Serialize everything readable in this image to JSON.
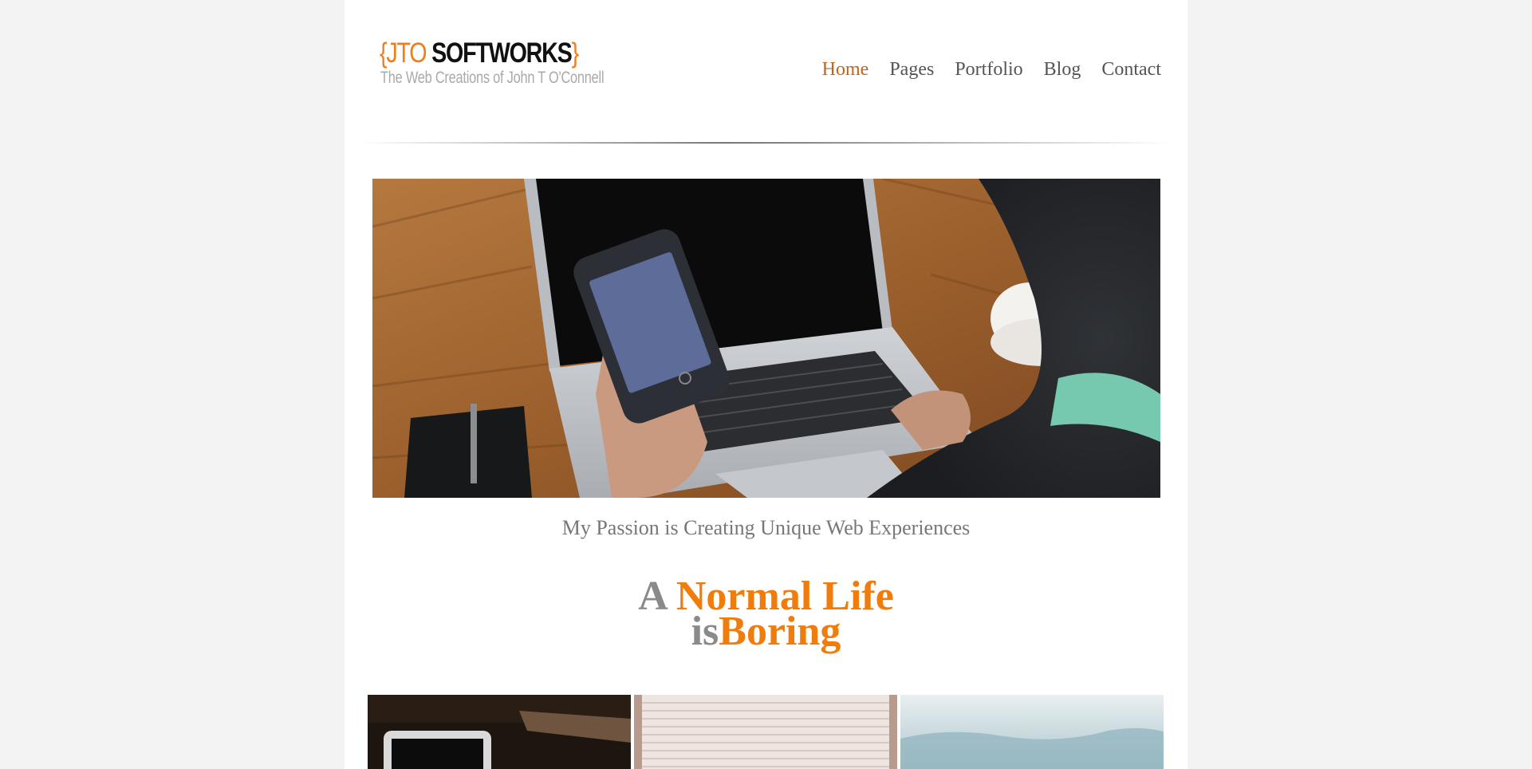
{
  "header": {
    "logo": {
      "open_brace": "{",
      "jto": "JTO",
      "softworks": " SOFTWORKS",
      "close_brace": "}"
    },
    "tagline": "The Web Creations of John T O'Connell",
    "nav": [
      {
        "label": "Home",
        "active": true
      },
      {
        "label": "Pages",
        "active": false
      },
      {
        "label": "Portfolio",
        "active": false
      },
      {
        "label": "Blog",
        "active": false
      },
      {
        "label": "Contact",
        "active": false
      }
    ]
  },
  "hero": {
    "caption": "My Passion is Creating Unique Web Experiences"
  },
  "headline": {
    "line1_a": "A ",
    "line1_b": "Normal Life",
    "line2_a": "is",
    "line2_b": "Boring"
  },
  "colors": {
    "accent": "#f07c0c",
    "nav_active": "#c0651a",
    "page_bg": "#f3f3f3"
  }
}
